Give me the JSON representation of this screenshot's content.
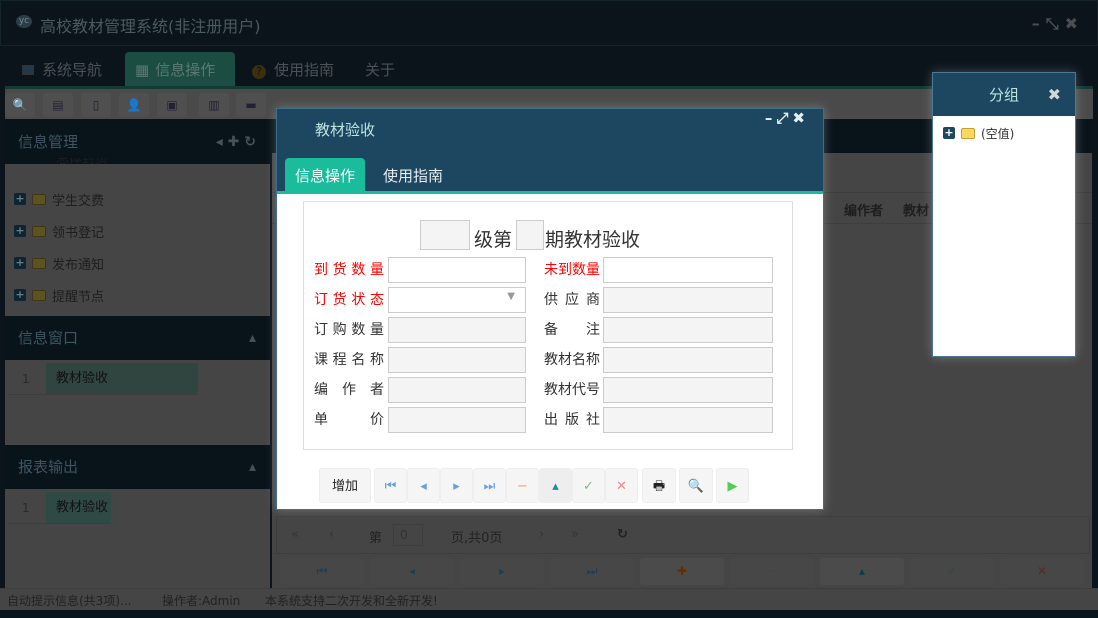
{
  "app": {
    "title": "高校教材管理系统(非注册用户)",
    "window_controls": [
      "minimize-icon",
      "restore-icon",
      "close-icon"
    ]
  },
  "menu": {
    "tabs": [
      {
        "label": "系统导航",
        "icon": "window-icon"
      },
      {
        "label": "信息操作",
        "icon": "grid-icon",
        "active": true
      },
      {
        "label": "使用指南",
        "icon": "help-icon"
      },
      {
        "label": "关于"
      }
    ]
  },
  "toolbar": {
    "icons": [
      "search-icon",
      "list-icon",
      "document-icon",
      "users-icon",
      "monitor-icon",
      "edit-icon",
      "window-icon"
    ]
  },
  "sidebar": {
    "info_mgmt": {
      "title": "信息管理",
      "tree": [
        {
          "label": "总体封页"
        },
        {
          "label": "学生交费"
        },
        {
          "label": "领书登记"
        },
        {
          "label": "发布通知"
        },
        {
          "label": "提醒节点"
        }
      ]
    },
    "info_window": {
      "title": "信息窗口",
      "items": [
        {
          "num": "1",
          "label": "教材验收"
        }
      ]
    },
    "report": {
      "title": "报表输出",
      "items": [
        {
          "num": "1",
          "label": "教材验收"
        }
      ]
    }
  },
  "grid": {
    "columns": [
      "编作者",
      "教材"
    ]
  },
  "pager": {
    "page_label": "第",
    "page_value": "0",
    "total": "页,共0页"
  },
  "status": {
    "info": "自动提示信息(共3项)...",
    "operator": "操作者:Admin",
    "message": "本系统支持二次开发和全新开发!"
  },
  "dialog": {
    "title": "教材验收",
    "tabs": [
      "信息操作",
      "使用指南"
    ],
    "heading": {
      "part1": "级第",
      "part2": "期教材验收"
    },
    "fields_left": [
      {
        "label": "到货数量",
        "required": true
      },
      {
        "label": "订货状态",
        "required": true,
        "type": "select"
      },
      {
        "label": "订购数量"
      },
      {
        "label": "课程名称"
      },
      {
        "label": "编 作 者"
      },
      {
        "label": "单 价"
      }
    ],
    "fields_right": [
      {
        "label": "未到数量",
        "required": true
      },
      {
        "label": "供 应 商"
      },
      {
        "label": "备 注"
      },
      {
        "label": "教材名称"
      },
      {
        "label": "教材代号"
      },
      {
        "label": "出 版 社"
      }
    ],
    "add_label": "增加"
  },
  "group": {
    "title": "分组",
    "item": "(空值)"
  }
}
